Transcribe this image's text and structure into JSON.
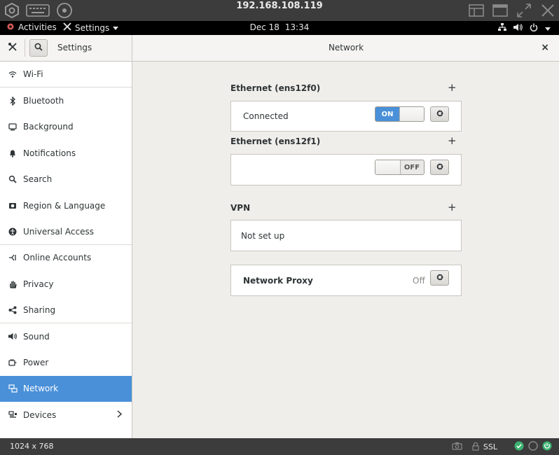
{
  "vnc": {
    "title": "192.168.108.119"
  },
  "topbar": {
    "activities": "Activities",
    "app_menu": "Settings",
    "date": "Dec 18",
    "time": "13:34"
  },
  "header": {
    "settings_title": "Settings",
    "page_title": "Network",
    "close_label": "×"
  },
  "sidebar": {
    "items": [
      {
        "label": "Wi-Fi",
        "icon": "wifi-icon"
      },
      {
        "label": "Bluetooth",
        "icon": "bluetooth-icon"
      },
      {
        "label": "Background",
        "icon": "background-icon"
      },
      {
        "label": "Notifications",
        "icon": "bell-icon"
      },
      {
        "label": "Search",
        "icon": "search-icon"
      },
      {
        "label": "Region & Language",
        "icon": "region-icon"
      },
      {
        "label": "Universal Access",
        "icon": "accessibility-icon"
      },
      {
        "label": "Online Accounts",
        "icon": "online-accounts-icon"
      },
      {
        "label": "Privacy",
        "icon": "hand-icon"
      },
      {
        "label": "Sharing",
        "icon": "share-icon"
      },
      {
        "label": "Sound",
        "icon": "speaker-icon"
      },
      {
        "label": "Power",
        "icon": "power-plug-icon"
      },
      {
        "label": "Network",
        "icon": "network-icon"
      },
      {
        "label": "Devices",
        "icon": "devices-icon"
      }
    ],
    "active_index": 12
  },
  "network": {
    "eth0": {
      "title": "Ethernet (ens12f0)",
      "status": "Connected",
      "switch_label": "ON"
    },
    "eth1": {
      "title": "Ethernet (ens12f1)",
      "status": "",
      "switch_label": "OFF"
    },
    "vpn": {
      "title": "VPN",
      "status": "Not set up"
    },
    "proxy": {
      "label": "Network Proxy",
      "status": "Off"
    },
    "add_symbol": "+"
  },
  "statusbar": {
    "resolution": "1024 x 768",
    "ssl": "SSL"
  },
  "colors": {
    "accent": "#4a90d9",
    "panel_bg": "#f0eeeb",
    "vnc_bg": "#3c3c3c"
  }
}
